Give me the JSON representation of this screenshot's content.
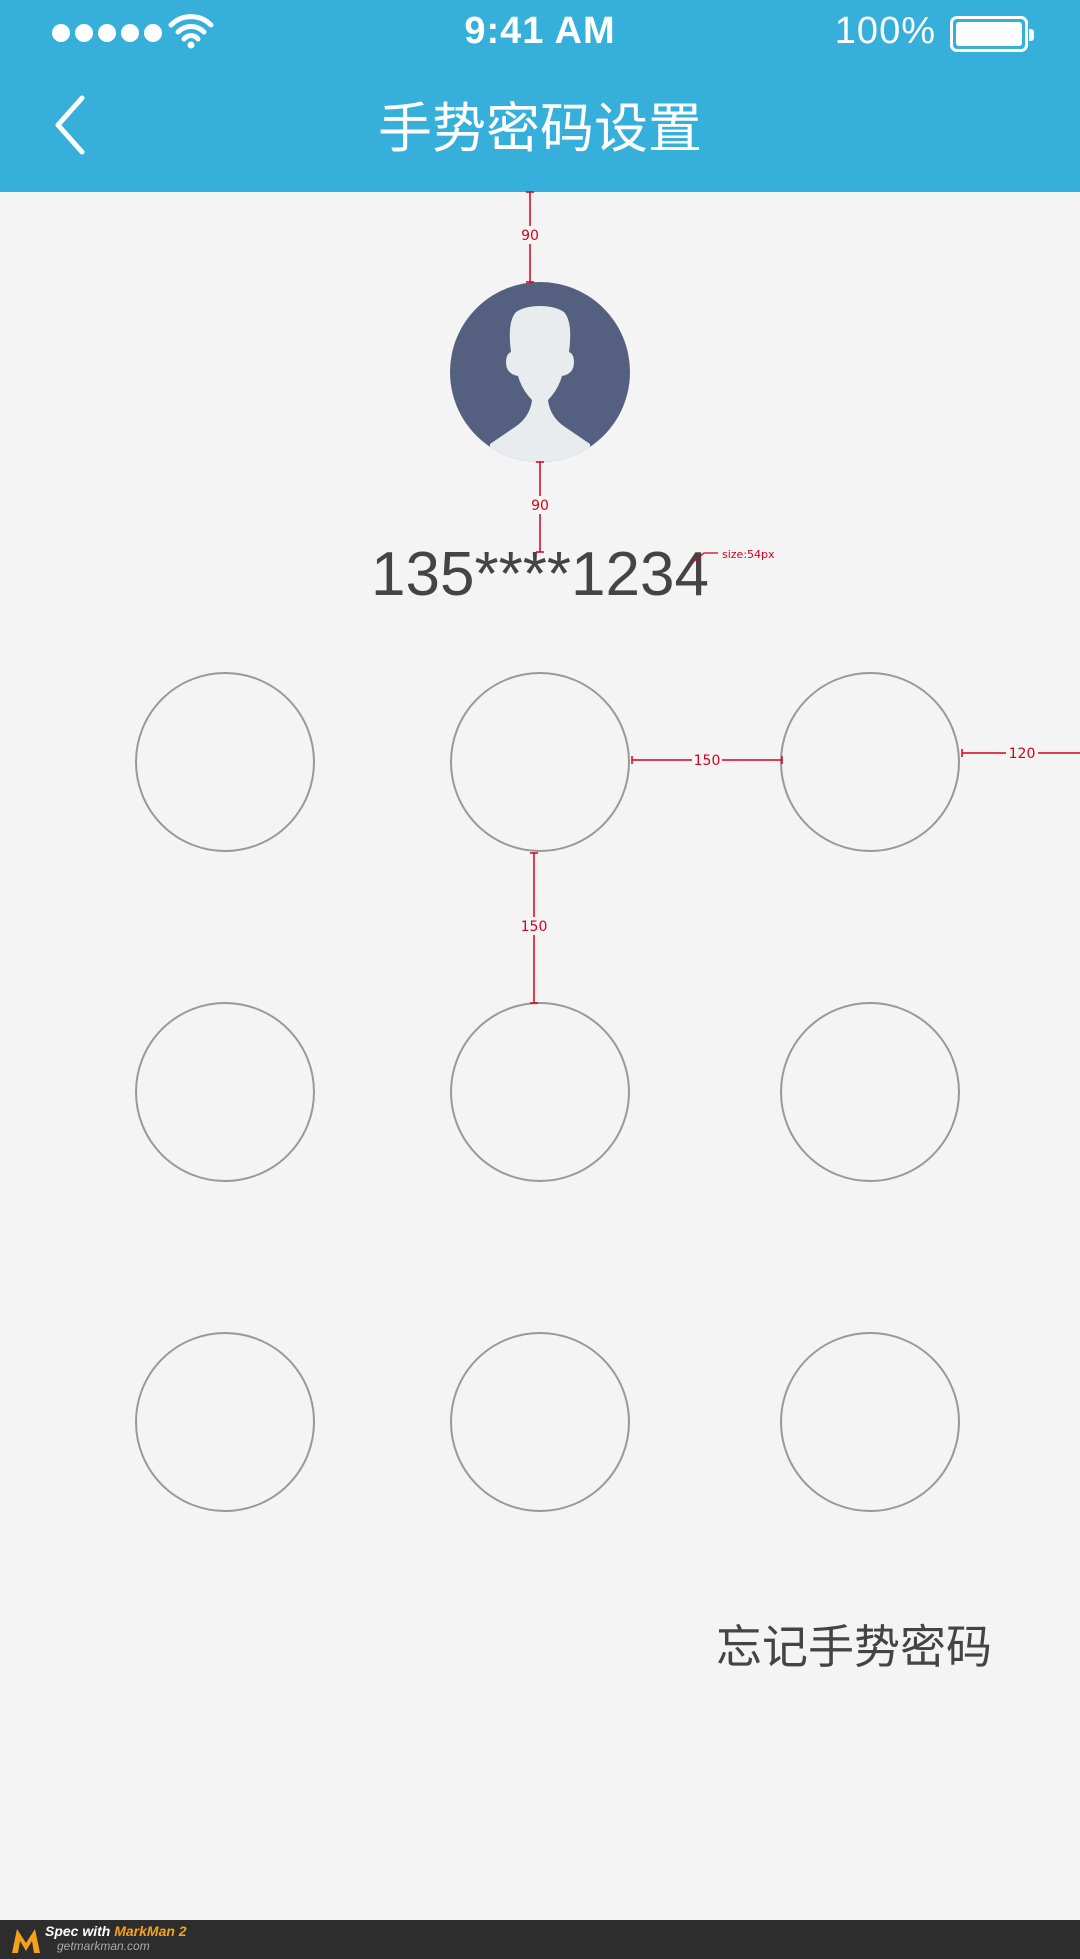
{
  "status_bar": {
    "time": "9:41 AM",
    "battery_text": "100%",
    "battery_level": 1.0,
    "signal_dots": 5,
    "wifi_icon": "wifi-icon"
  },
  "nav": {
    "title": "手势密码设置",
    "back_icon": "chevron-left-icon"
  },
  "user": {
    "avatar_icon": "user-silhouette-icon",
    "phone": "135****1234"
  },
  "gesture_grid": {
    "rows": 3,
    "cols": 3
  },
  "forgot_link": "忘记手势密码",
  "annotations": {
    "top_spacing": "90",
    "avatar_spacing": "90",
    "font_size": "size:54px",
    "horizontal_gap": "150",
    "right_margin": "120",
    "vertical_gap": "150"
  },
  "footer": {
    "brand_prefix": "Spec with ",
    "brand_name": "MarkMan 2",
    "url": "getmarkman.com"
  },
  "colors": {
    "header": "#36b0db",
    "background": "#f4f4f4",
    "avatar_bg": "#555f7f",
    "annotation": "#d6001c",
    "circle_stroke": "#999999"
  }
}
